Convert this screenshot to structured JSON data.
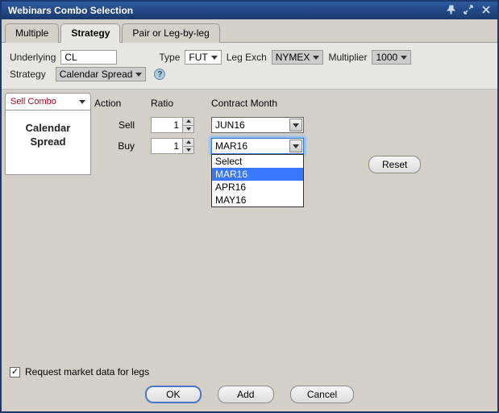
{
  "title": "Webinars Combo Selection",
  "tabs": [
    "Multiple",
    "Strategy",
    "Pair or Leg-by-leg"
  ],
  "active_tab_index": 1,
  "params": {
    "underlying_label": "Underlying",
    "underlying_value": "CL",
    "type_label": "Type",
    "type_value": "FUT",
    "leg_exch_label": "Leg Exch",
    "leg_exch_value": "NYMEX",
    "multiplier_label": "Multiplier",
    "multiplier_value": "1000",
    "strategy_label": "Strategy",
    "strategy_value": "Calendar Spread"
  },
  "side": {
    "tab_label": "Sell Combo",
    "body_line1": "Calendar",
    "body_line2": "Spread"
  },
  "columns": {
    "action": "Action",
    "ratio": "Ratio",
    "month": "Contract Month"
  },
  "legs": [
    {
      "action": "Sell",
      "ratio": "1",
      "month": "JUN16"
    },
    {
      "action": "Buy",
      "ratio": "1",
      "month": "MAR16"
    }
  ],
  "month_options": [
    "Select",
    "MAR16",
    "APR16",
    "MAY16"
  ],
  "month_selected_index": 1,
  "reset_label": "Reset",
  "request_md_label": "Request market data for legs",
  "request_md_checked": true,
  "buttons": {
    "ok": "OK",
    "add": "Add",
    "cancel": "Cancel"
  }
}
